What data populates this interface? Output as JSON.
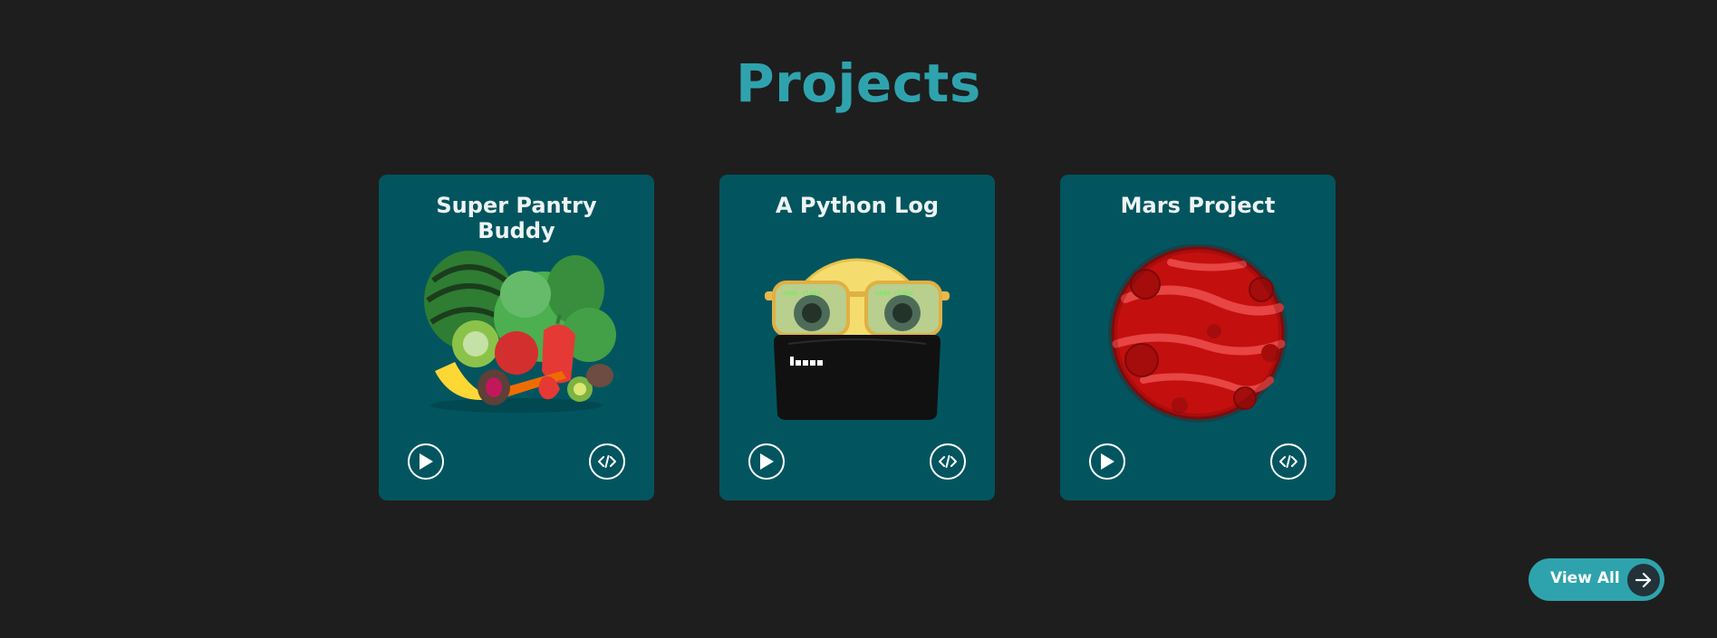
{
  "section": {
    "title": "Projects"
  },
  "projects": [
    {
      "title": "Super Pantry Buddy",
      "image_icon": "fruits-vegetables-illustration",
      "demo_icon": "play-icon",
      "code_icon": "code-icon"
    },
    {
      "title": "A Python Log",
      "image_icon": "hacker-emoji-laptop-illustration",
      "demo_icon": "play-icon",
      "code_icon": "code-icon"
    },
    {
      "title": "Mars Project",
      "image_icon": "mars-planet-illustration",
      "demo_icon": "play-icon",
      "code_icon": "code-icon"
    }
  ],
  "view_all": {
    "label": "View All",
    "icon": "arrow-right-icon"
  },
  "colors": {
    "background": "#1e1e1e",
    "accent": "#2fa3ad",
    "card": "#02555f",
    "card_text": "#eef4f4"
  }
}
